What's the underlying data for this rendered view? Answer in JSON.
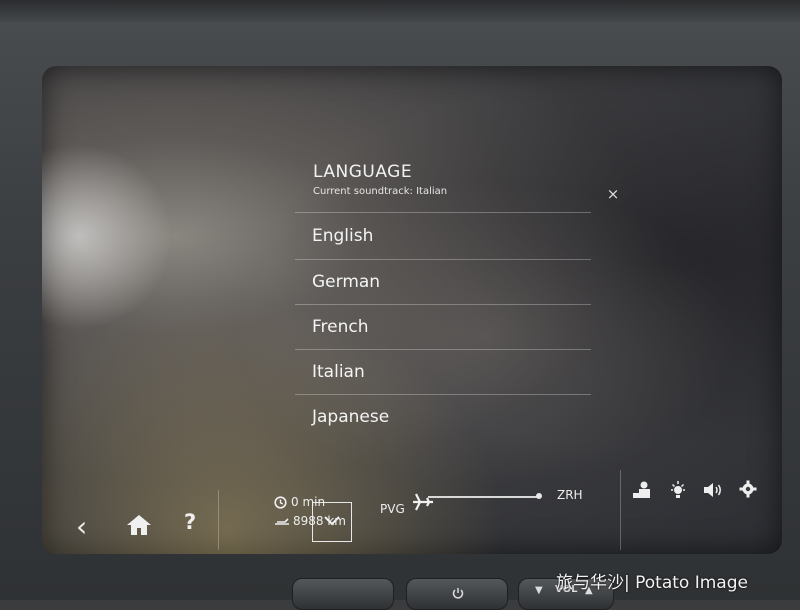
{
  "language_menu": {
    "title": "LANGUAGE",
    "subtitle": "Current soundtrack: Italian",
    "close_icon": "×",
    "languages": [
      "English",
      "German",
      "French",
      "Italian",
      "Japanese"
    ],
    "scroll_down_icon": "chevron-down"
  },
  "bottom_bar": {
    "back_icon": "‹",
    "home_icon": "home",
    "help_icon": "?",
    "time_remaining": "0 min",
    "distance": "8988 km",
    "origin": "PVG",
    "destination": "ZRH",
    "flight_progress": 1.0
  },
  "hardware": {
    "vol_label": "VOL"
  },
  "watermark": "旅与华沙| Potato Image"
}
